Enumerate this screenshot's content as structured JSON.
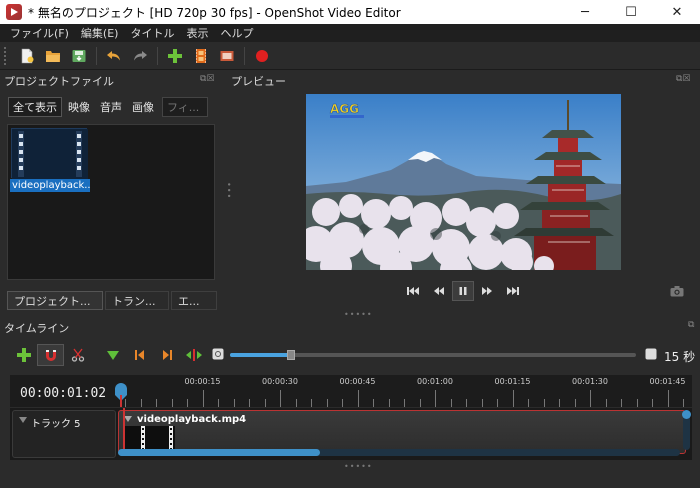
{
  "window": {
    "title": "* 無名のプロジェクト [HD 720p 30 fps] - OpenShot Video Editor",
    "minimize": "─",
    "maximize": "☐",
    "close": "✕"
  },
  "menu": [
    "ファイル(F)",
    "編集(E)",
    "タイトル",
    "表示",
    "ヘルプ"
  ],
  "toolbar": {
    "icons": [
      "new-file-icon",
      "open-folder-icon",
      "save-icon",
      "undo-icon",
      "redo-icon",
      "add-file-icon",
      "export-film-icon",
      "fullscreen-icon",
      "record-icon"
    ]
  },
  "project_files": {
    "title": "プロジェクトファイル",
    "filters": [
      "全て表示",
      "映像",
      "音声",
      "画像"
    ],
    "active_filter": 0,
    "search_placeholder": "フィ...",
    "files": [
      {
        "name": "videoplayback...."
      }
    ],
    "bottom_tabs": [
      "プロジェクト...",
      "トラン...",
      "エ..."
    ]
  },
  "preview": {
    "title": "プレビュー",
    "watermark": "AGG"
  },
  "timeline": {
    "title": "タイムライン",
    "zoom_label": "15 秒",
    "zoom_level": 0.15,
    "current_time": "00:00:01:02",
    "ticks": [
      "00:00:15",
      "00:00:30",
      "00:00:45",
      "00:01:00",
      "00:01:15",
      "00:01:30",
      "00:01:45"
    ],
    "tracks": [
      {
        "name": "トラック 5",
        "clips": [
          {
            "name": "videoplayback.mp4"
          }
        ]
      }
    ],
    "scroll_fraction": 0.36
  }
}
